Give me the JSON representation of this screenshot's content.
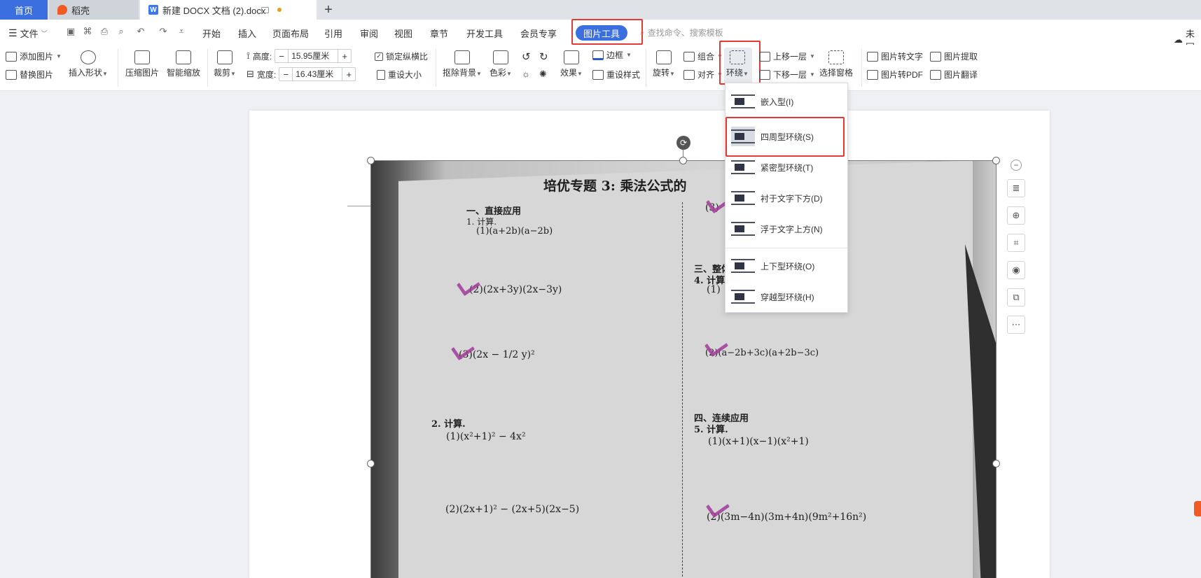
{
  "tabs": {
    "home": "首页",
    "shell": "稻壳",
    "doc": "新建 DOCX 文档 (2).docx",
    "new_tab": "+"
  },
  "menubar": {
    "file": "文件",
    "items": [
      "开始",
      "插入",
      "页面布局",
      "引用",
      "审阅",
      "视图",
      "章节",
      "开发工具",
      "会员专享"
    ],
    "picture_tools": "图片工具",
    "search_placeholder": "查找命令、搜索模板",
    "cloud": "未同"
  },
  "ribbon": {
    "add_picture": "添加图片",
    "replace_picture": "替换图片",
    "insert_shape": "插入形状",
    "compress": "压缩图片",
    "smart_scale": "智能缩放",
    "crop": "裁剪",
    "height_label": "高度:",
    "height_value": "15.95厘米",
    "width_label": "宽度:",
    "width_value": "16.43厘米",
    "lock_ratio": "锁定纵横比",
    "reset_size": "重设大小",
    "remove_bg": "抠除背景",
    "color": "色彩",
    "effect": "效果",
    "border": "边框",
    "reset_style": "重设样式",
    "rotate": "旋转",
    "group": "组合",
    "align": "对齐",
    "wrap": "环绕",
    "bring_forward": "上移一层",
    "send_backward": "下移一层",
    "select_pane": "选择窗格",
    "pic_to_text": "图片转文字",
    "pic_extract": "图片提取",
    "pic_to_pdf": "图片转PDF",
    "pic_translate": "图片翻译"
  },
  "wrap_menu": {
    "items": [
      "嵌入型(I)",
      "四周型环绕(S)",
      "紧密型环绕(T)",
      "衬于文字下方(D)",
      "浮于文字上方(N)",
      "上下型环绕(O)",
      "穿越型环绕(H)"
    ],
    "selected_index": 1
  },
  "photo": {
    "title": "培优专题 3: 乘法公式的",
    "section1": "一、直接应用",
    "q1": "1. 计算.",
    "q1_1": "(1)(a+2b)(a−2b)",
    "q1_2": "(2)(2x+3y)(2x−3y)",
    "q1_3": "(3)(2x − 1/2 y)²",
    "q2": "2. 计算.",
    "q2_1": "(1)(x²+1)² − 4x²",
    "q2_2": "(2)(2x+1)² − (2x+5)(2x−5)",
    "r_top": "(3)",
    "section3": "三、整体",
    "q4": "4. 计算",
    "q4_1": "(1)",
    "q4_2": "(2)(a−2b+3c)(a+2b−3c)",
    "section4": "四、连续应用",
    "q5": "5. 计算.",
    "q5_1": "(1)(x+1)(x−1)(x²+1)",
    "q5_2": "(2)(3m−4n)(3m+4n)(9m²+16n²)"
  },
  "colors": {
    "accent": "#3b6fe0",
    "highlight": "#e53935",
    "check_mark": "#a23a9b"
  }
}
